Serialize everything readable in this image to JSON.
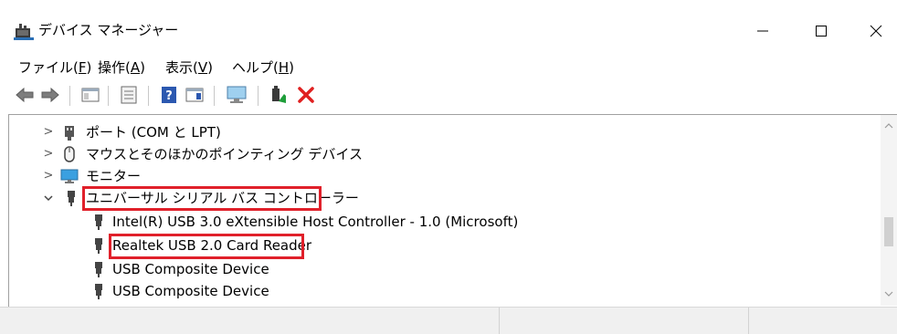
{
  "window": {
    "title": "デバイス マネージャー",
    "controls": [
      "minimize",
      "maximize",
      "close"
    ]
  },
  "menu": [
    {
      "label": "ファイル(",
      "accel": "F",
      "suffix": ")"
    },
    {
      "label": "操作(",
      "accel": "A",
      "suffix": ")"
    },
    {
      "label": "表示(",
      "accel": "V",
      "suffix": ")"
    },
    {
      "label": "ヘルプ(",
      "accel": "H",
      "suffix": ")"
    }
  ],
  "toolbar": {
    "buttons": [
      {
        "name": "back-icon"
      },
      {
        "name": "forward-icon"
      },
      {
        "name": "console-tree-icon"
      },
      {
        "name": "properties-icon"
      },
      {
        "name": "help-icon"
      },
      {
        "name": "action-pane-icon"
      },
      {
        "name": "scan-hardware-icon"
      },
      {
        "name": "update-driver-icon"
      },
      {
        "name": "uninstall-device-icon"
      }
    ]
  },
  "tree": {
    "categories": [
      {
        "label": "ポート (COM と LPT)",
        "expander": ">",
        "icon": "port-icon"
      },
      {
        "label": "マウスとそのほかのポインティング デバイス",
        "expander": ">",
        "icon": "mouse-icon"
      },
      {
        "label": "モニター",
        "expander": ">",
        "icon": "monitor-icon"
      },
      {
        "label": "ユニバーサル シリアル バス コントローラー",
        "expander": "v",
        "icon": "usb-icon",
        "highlighted": true
      }
    ],
    "usb_children": [
      {
        "label": "Intel(R) USB 3.0 eXtensible Host Controller - 1.0 (Microsoft)",
        "icon": "usb-icon"
      },
      {
        "label": "Realtek USB 2.0 Card Reader",
        "icon": "usb-icon",
        "highlighted": true
      },
      {
        "label": "USB Composite Device",
        "icon": "usb-icon"
      },
      {
        "label": "USB Composite Device",
        "icon": "usb-icon"
      }
    ]
  },
  "colors": {
    "highlight_border": "#e0202a",
    "statusbar_bg": "#f0f0f0",
    "tree_border": "#a0a0a0"
  }
}
